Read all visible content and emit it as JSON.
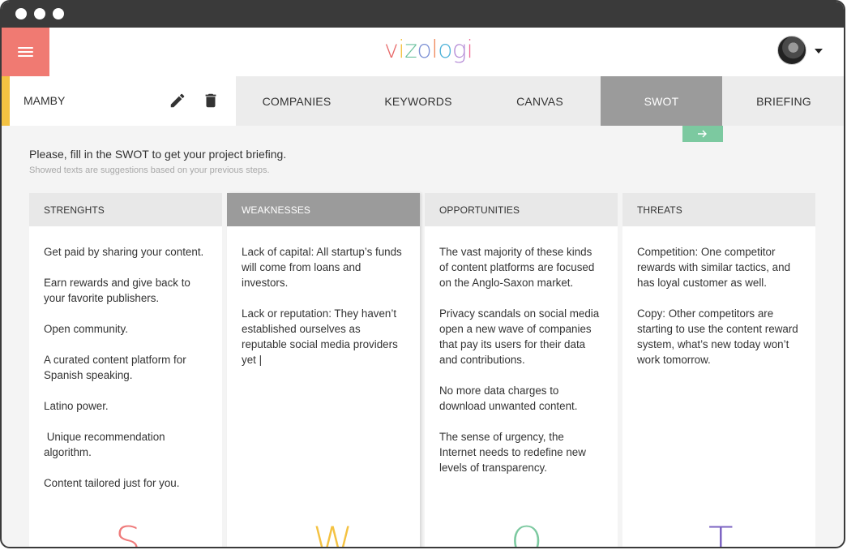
{
  "window": {
    "dots": [
      "close",
      "minimize",
      "maximize"
    ]
  },
  "header": {
    "menu_icon": "hamburger-icon",
    "logo": {
      "letters": [
        "v",
        "i",
        "z",
        "o",
        "l",
        "o",
        "g",
        "i"
      ],
      "colors": [
        "#e86a6a",
        "#f4c242",
        "#6fc3a0",
        "#7b8fd4",
        "#f08a5d",
        "#4fb3d9",
        "#b48ad6",
        "#ef6f9a"
      ]
    },
    "avatar_icon": "user-avatar",
    "caret_icon": "chevron-down-icon"
  },
  "project": {
    "name": "MAMBY",
    "edit_icon": "pencil-icon",
    "delete_icon": "trash-icon",
    "accent": "#f4c242"
  },
  "tabs": [
    {
      "label": "COMPANIES"
    },
    {
      "label": "KEYWORDS"
    },
    {
      "label": "CANVAS"
    },
    {
      "label": "SWOT",
      "active": true
    },
    {
      "label": "BRIEFING"
    }
  ],
  "next_button": {
    "icon": "arrow-right-icon",
    "color": "#7cc9a0"
  },
  "intro": {
    "title": "Please, fill in the SWOT to get your project briefing.",
    "hint": "Showed texts are suggestions based on your previous steps."
  },
  "swot": [
    {
      "heading": "STRENGHTS",
      "letter": "S",
      "color": "#ef7b7b",
      "items": [
        "Get paid by sharing your content.",
        "Earn rewards and give back to your favorite publishers.",
        "Open community.",
        "A curated content platform for Spanish speaking.",
        "Latino power.",
        " Unique recommendation algorithm.",
        "Content tailored just for you."
      ]
    },
    {
      "heading": "WEAKNESSES",
      "letter": "W",
      "color": "#f4c242",
      "active": true,
      "items": [
        "Lack of capital: All startup’s funds will come from loans and investors.",
        "Lack or reputation: They haven’t established ourselves as reputable social media providers yet |"
      ]
    },
    {
      "heading": "OPPORTUNITIES",
      "letter": "O",
      "color": "#7cc9a0",
      "items": [
        "The vast majority of these kinds of content platforms are focused on the Anglo-Saxon market.",
        "Privacy scandals on social media open a new wave of companies that pay its users for their data and contributions.",
        "No more data charges to download unwanted content.",
        "The sense of urgency, the Internet needs to redefine new levels of transparency."
      ]
    },
    {
      "heading": "THREATS",
      "letter": "T",
      "color": "#7b62c2",
      "items": [
        "Competition: One competitor rewards with similar tactics, and has loyal customer as well.",
        "Copy: Other competitors are starting to use the content reward system, what’s new today won’t work tomorrow."
      ]
    }
  ]
}
